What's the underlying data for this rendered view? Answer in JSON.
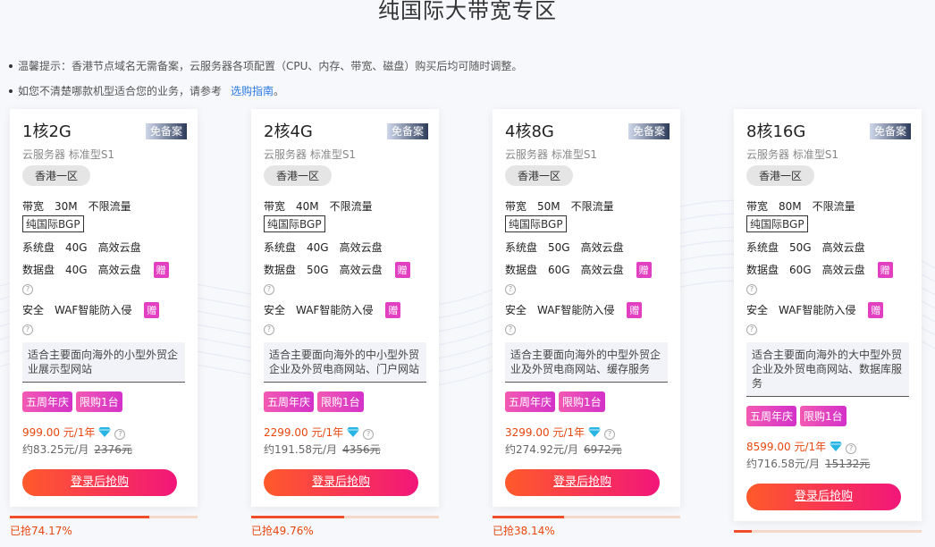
{
  "title": "纯国际大带宽专区",
  "tips": [
    {
      "text": "温馨提示：香港节点域名无需备案，云服务器各项配置（CPU、内存、带宽、磁盘）购买后均可随时调整。"
    },
    {
      "text": "如您不清楚哪款机型适合您的业务，请参考",
      "link": "选购指南",
      "suffix": "。"
    }
  ],
  "common": {
    "badge": "免备案",
    "subtitle": "云服务器 标准型S1",
    "region": "香港一区",
    "bandwidth_label": "带宽",
    "unlimited": "不限流量",
    "bgp": "纯国际BGP",
    "sysdisk_label": "系统盘",
    "datadisk_label": "数据盘",
    "disk_type": "高效云盘",
    "gift": "赠",
    "security_label": "安全",
    "waf": "WAF智能防入侵",
    "tag1": "五周年庆",
    "tag2": "限购1台",
    "button": "登录后抢购",
    "help": "?"
  },
  "cards": [
    {
      "spec": "1核2G",
      "bandwidth": "30M",
      "sysdisk": "40G",
      "datadisk": "40G",
      "desc": "适合主要面向海外的小型外贸企业展示型网站",
      "price": "999.00 元/1年",
      "monthly": "约83.25元/月",
      "original": "2376元",
      "sold": "已抢74.17%",
      "sold_pct": 74.17
    },
    {
      "spec": "2核4G",
      "bandwidth": "40M",
      "sysdisk": "40G",
      "datadisk": "50G",
      "desc": "适合主要面向海外的中小型外贸企业及外贸电商网站、门户网站",
      "price": "2299.00 元/1年",
      "monthly": "约191.58元/月",
      "original": "4356元",
      "sold": "已抢49.76%",
      "sold_pct": 49.76
    },
    {
      "spec": "4核8G",
      "bandwidth": "50M",
      "sysdisk": "50G",
      "datadisk": "60G",
      "desc": "适合主要面向海外的中型外贸企业及外贸电商网站、缓存服务",
      "price": "3299.00 元/1年",
      "monthly": "约274.92元/月",
      "original": "6972元",
      "sold": "已抢38.14%",
      "sold_pct": 38.14
    },
    {
      "spec": "8核16G",
      "bandwidth": "80M",
      "sysdisk": "50G",
      "datadisk": "60G",
      "desc": "适合主要面向海外的大中型外贸企业及外贸电商网站、数据库服务",
      "price": "8599.00 元/1年",
      "monthly": "约716.58元/月",
      "original": "15132元",
      "sold_pct": 9.5
    }
  ]
}
